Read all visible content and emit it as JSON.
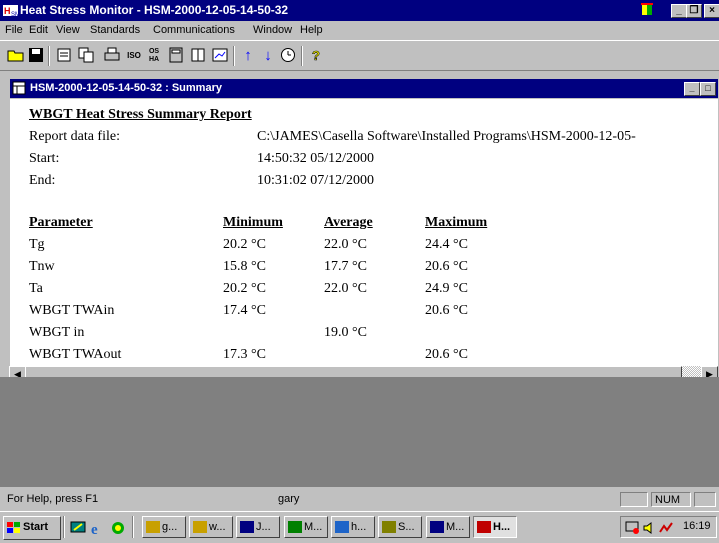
{
  "app": {
    "title": "Heat Stress Monitor - HSM-2000-12-05-14-50-32",
    "icon_name": "hsm-app-icon"
  },
  "menu": [
    "File",
    "Edit",
    "View",
    "Standards",
    "Communications",
    "Window",
    "Help"
  ],
  "toolbar": {
    "buttons": [
      "open-icon",
      "save-icon",
      "properties-icon",
      "copy-icon",
      "print-icon",
      "iso-icon",
      "os-ha-icon",
      "calculator-icon",
      "book-icon",
      "chart-icon",
      "up-arrow-icon",
      "down-arrow-icon",
      "clock-icon",
      "help-icon"
    ],
    "iso_label": "ISO",
    "osha_label": "OS HA"
  },
  "child_window": {
    "title": "HSM-2000-12-05-14-50-32 : Summary"
  },
  "report": {
    "heading": "WBGT Heat Stress Summary Report",
    "data_file_label": "Report data file:",
    "data_file_value": "C:\\JAMES\\Casella Software\\Installed Programs\\HSM-2000-12-05-",
    "start_label": "Start:",
    "start_value": "14:50:32  05/12/2000",
    "end_label": "End:",
    "end_value": "10:31:02  07/12/2000",
    "columns": [
      "Parameter",
      "Minimum",
      "Average",
      "Maximum"
    ],
    "rows": [
      [
        "Tg",
        "20.2 °C",
        "22.0 °C",
        "24.4 °C"
      ],
      [
        "Tnw",
        "15.8 °C",
        "17.7 °C",
        "20.6 °C"
      ],
      [
        "Ta",
        "20.2 °C",
        "22.0 °C",
        "24.9 °C"
      ],
      [
        "WBGT TWAin",
        "17.4 °C",
        "",
        "20.6 °C"
      ],
      [
        "WBGT in",
        "",
        "19.0 °C",
        ""
      ],
      [
        "WBGT TWAout",
        "17.3 °C",
        "",
        "20.6 °C"
      ]
    ]
  },
  "statusbar": {
    "help": "For Help, press F1",
    "user": "gary",
    "num": "NUM"
  },
  "taskbar": {
    "start": "Start",
    "tasks": [
      "g...",
      "w...",
      "J...",
      "M...",
      "h...",
      "S...",
      "M...",
      "H..."
    ],
    "clock": "16:19"
  },
  "colors": {
    "title_bar": "#000080",
    "face": "#c0c0c0",
    "workspace": "#808080"
  }
}
